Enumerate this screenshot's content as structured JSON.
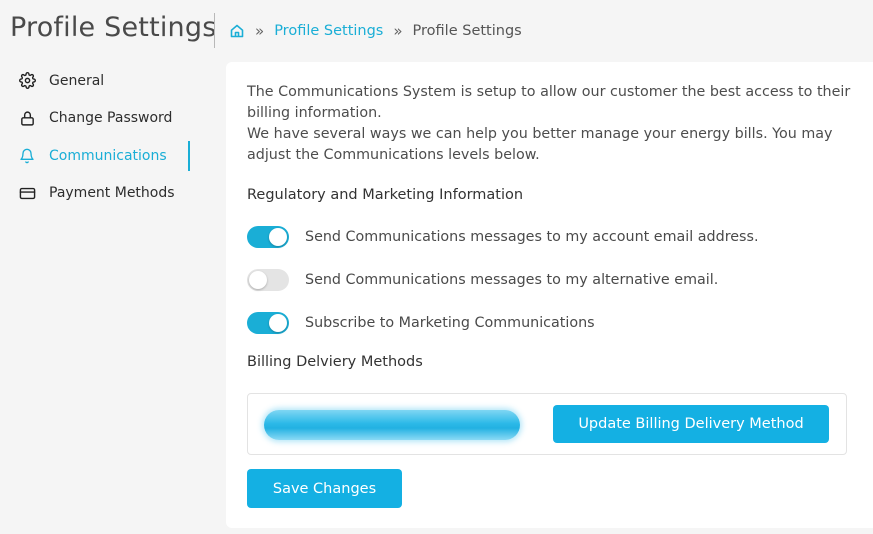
{
  "header": {
    "title": "Profile Settings",
    "breadcrumb": {
      "home_icon": "home-icon",
      "separator": "»",
      "link": "Profile Settings",
      "current": "Profile Settings"
    }
  },
  "sidebar": {
    "items": [
      {
        "label": "General",
        "icon": "gear-icon",
        "active": false
      },
      {
        "label": "Change Password",
        "icon": "lock-icon",
        "active": false
      },
      {
        "label": "Communications",
        "icon": "bell-icon",
        "active": true
      },
      {
        "label": "Payment Methods",
        "icon": "credit-card-icon",
        "active": false
      }
    ]
  },
  "main": {
    "intro_line1": "The Communications System is setup to allow our customer the best access to their billing information.",
    "intro_line2": "We have several ways we can help you better manage your energy bills. You may adjust the Communications levels below.",
    "regulatory_title": "Regulatory and Marketing Information",
    "toggles": [
      {
        "label": "Send Communications messages to my account email address.",
        "on": true
      },
      {
        "label": "Send Communications messages to my alternative email.",
        "on": false
      },
      {
        "label": "Subscribe to Marketing Communications",
        "on": true
      }
    ],
    "billing_title": "Billing Delviery Methods",
    "update_button": "Update Billing Delivery Method",
    "save_button": "Save Changes"
  },
  "colors": {
    "accent": "#1aaed6",
    "button": "#14b0e3",
    "toggle_off": "#e4e4e4",
    "background": "#f5f5f5"
  }
}
